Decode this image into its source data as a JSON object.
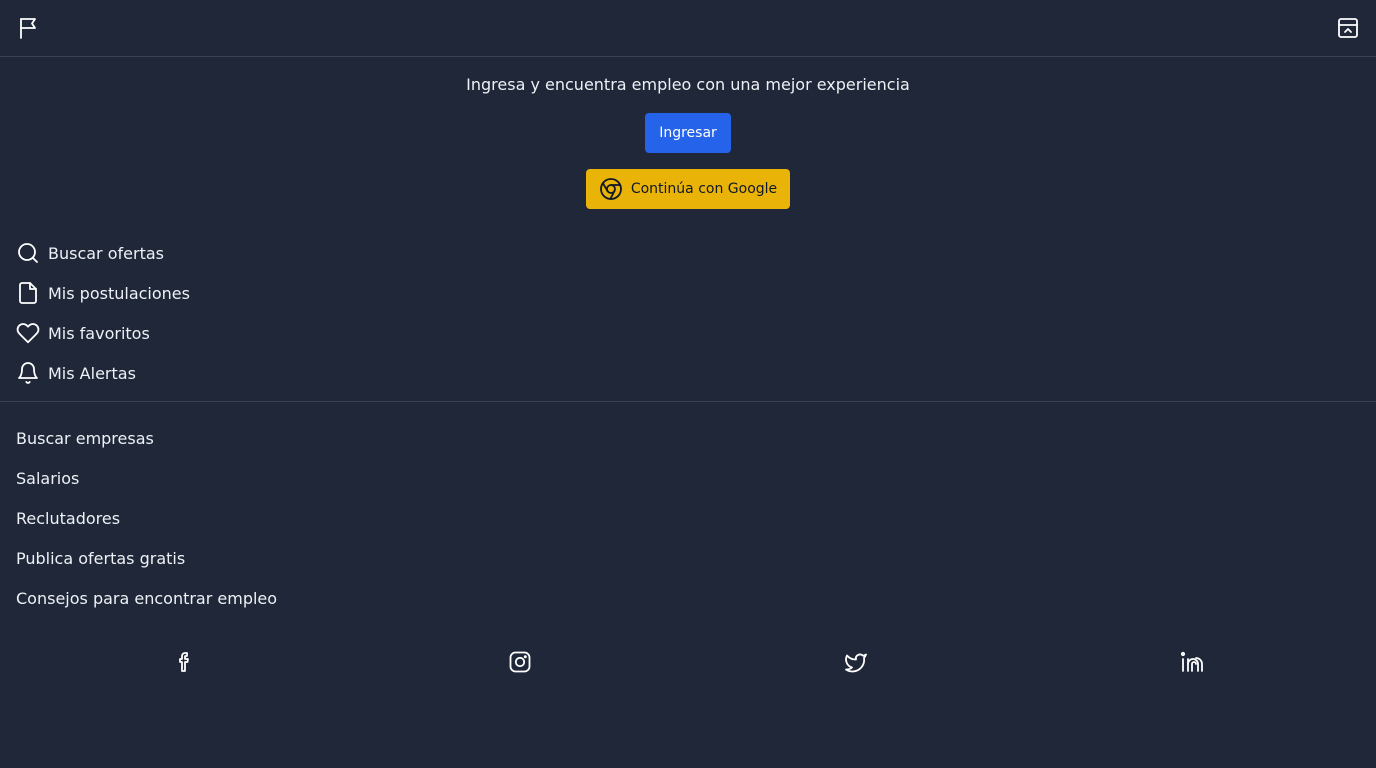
{
  "header": {
    "left_icon": "flag-icon",
    "right_icon": "panel-collapse-icon"
  },
  "promo": {
    "text": "Ingresa y encuentra empleo con una mejor experiencia",
    "login_label": "Ingresar",
    "google_label": "Continúa con Google",
    "google_icon": "chrome-icon",
    "login_color": "#2563eb",
    "google_color": "#eab308"
  },
  "menu": {
    "items": [
      {
        "label": "Buscar ofertas",
        "icon": "search-icon"
      },
      {
        "label": "Mis postulaciones",
        "icon": "file-icon"
      },
      {
        "label": "Mis favoritos",
        "icon": "heart-icon"
      },
      {
        "label": "Mis Alertas",
        "icon": "bell-icon"
      }
    ]
  },
  "links": {
    "items": [
      {
        "label": "Buscar empresas"
      },
      {
        "label": "Salarios"
      },
      {
        "label": "Reclutadores"
      },
      {
        "label": "Publica ofertas gratis"
      },
      {
        "label": "Consejos para encontrar empleo"
      }
    ]
  },
  "social": {
    "items": [
      {
        "icon": "facebook-icon"
      },
      {
        "icon": "instagram-icon"
      },
      {
        "icon": "twitter-icon"
      },
      {
        "icon": "linkedin-icon"
      }
    ]
  },
  "colors": {
    "background": "#1f2739",
    "text": "#eef1f5",
    "divider": "#3a4253"
  }
}
